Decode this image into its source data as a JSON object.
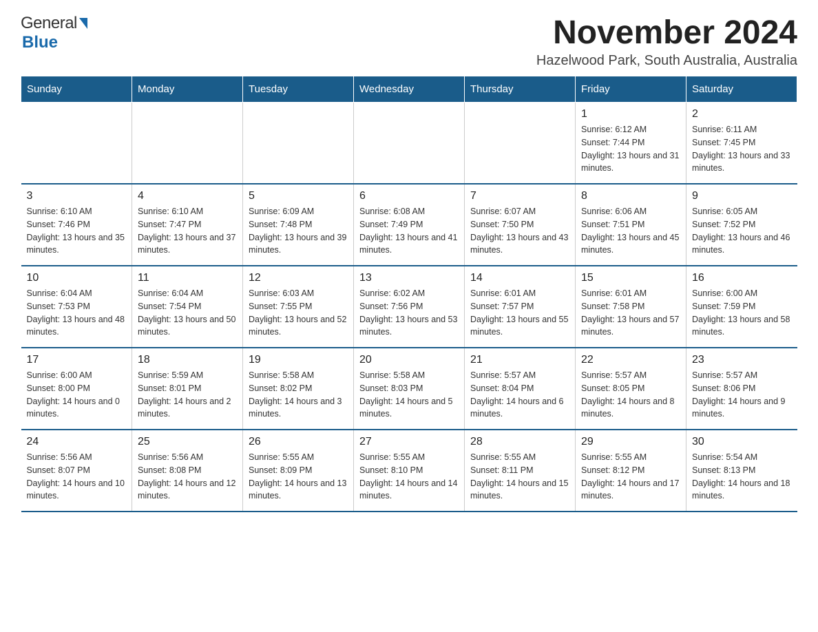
{
  "header": {
    "logo_general": "General",
    "logo_blue": "Blue",
    "month_title": "November 2024",
    "location": "Hazelwood Park, South Australia, Australia"
  },
  "weekdays": [
    "Sunday",
    "Monday",
    "Tuesday",
    "Wednesday",
    "Thursday",
    "Friday",
    "Saturday"
  ],
  "weeks": [
    [
      {
        "day": "",
        "sunrise": "",
        "sunset": "",
        "daylight": ""
      },
      {
        "day": "",
        "sunrise": "",
        "sunset": "",
        "daylight": ""
      },
      {
        "day": "",
        "sunrise": "",
        "sunset": "",
        "daylight": ""
      },
      {
        "day": "",
        "sunrise": "",
        "sunset": "",
        "daylight": ""
      },
      {
        "day": "",
        "sunrise": "",
        "sunset": "",
        "daylight": ""
      },
      {
        "day": "1",
        "sunrise": "Sunrise: 6:12 AM",
        "sunset": "Sunset: 7:44 PM",
        "daylight": "Daylight: 13 hours and 31 minutes."
      },
      {
        "day": "2",
        "sunrise": "Sunrise: 6:11 AM",
        "sunset": "Sunset: 7:45 PM",
        "daylight": "Daylight: 13 hours and 33 minutes."
      }
    ],
    [
      {
        "day": "3",
        "sunrise": "Sunrise: 6:10 AM",
        "sunset": "Sunset: 7:46 PM",
        "daylight": "Daylight: 13 hours and 35 minutes."
      },
      {
        "day": "4",
        "sunrise": "Sunrise: 6:10 AM",
        "sunset": "Sunset: 7:47 PM",
        "daylight": "Daylight: 13 hours and 37 minutes."
      },
      {
        "day": "5",
        "sunrise": "Sunrise: 6:09 AM",
        "sunset": "Sunset: 7:48 PM",
        "daylight": "Daylight: 13 hours and 39 minutes."
      },
      {
        "day": "6",
        "sunrise": "Sunrise: 6:08 AM",
        "sunset": "Sunset: 7:49 PM",
        "daylight": "Daylight: 13 hours and 41 minutes."
      },
      {
        "day": "7",
        "sunrise": "Sunrise: 6:07 AM",
        "sunset": "Sunset: 7:50 PM",
        "daylight": "Daylight: 13 hours and 43 minutes."
      },
      {
        "day": "8",
        "sunrise": "Sunrise: 6:06 AM",
        "sunset": "Sunset: 7:51 PM",
        "daylight": "Daylight: 13 hours and 45 minutes."
      },
      {
        "day": "9",
        "sunrise": "Sunrise: 6:05 AM",
        "sunset": "Sunset: 7:52 PM",
        "daylight": "Daylight: 13 hours and 46 minutes."
      }
    ],
    [
      {
        "day": "10",
        "sunrise": "Sunrise: 6:04 AM",
        "sunset": "Sunset: 7:53 PM",
        "daylight": "Daylight: 13 hours and 48 minutes."
      },
      {
        "day": "11",
        "sunrise": "Sunrise: 6:04 AM",
        "sunset": "Sunset: 7:54 PM",
        "daylight": "Daylight: 13 hours and 50 minutes."
      },
      {
        "day": "12",
        "sunrise": "Sunrise: 6:03 AM",
        "sunset": "Sunset: 7:55 PM",
        "daylight": "Daylight: 13 hours and 52 minutes."
      },
      {
        "day": "13",
        "sunrise": "Sunrise: 6:02 AM",
        "sunset": "Sunset: 7:56 PM",
        "daylight": "Daylight: 13 hours and 53 minutes."
      },
      {
        "day": "14",
        "sunrise": "Sunrise: 6:01 AM",
        "sunset": "Sunset: 7:57 PM",
        "daylight": "Daylight: 13 hours and 55 minutes."
      },
      {
        "day": "15",
        "sunrise": "Sunrise: 6:01 AM",
        "sunset": "Sunset: 7:58 PM",
        "daylight": "Daylight: 13 hours and 57 minutes."
      },
      {
        "day": "16",
        "sunrise": "Sunrise: 6:00 AM",
        "sunset": "Sunset: 7:59 PM",
        "daylight": "Daylight: 13 hours and 58 minutes."
      }
    ],
    [
      {
        "day": "17",
        "sunrise": "Sunrise: 6:00 AM",
        "sunset": "Sunset: 8:00 PM",
        "daylight": "Daylight: 14 hours and 0 minutes."
      },
      {
        "day": "18",
        "sunrise": "Sunrise: 5:59 AM",
        "sunset": "Sunset: 8:01 PM",
        "daylight": "Daylight: 14 hours and 2 minutes."
      },
      {
        "day": "19",
        "sunrise": "Sunrise: 5:58 AM",
        "sunset": "Sunset: 8:02 PM",
        "daylight": "Daylight: 14 hours and 3 minutes."
      },
      {
        "day": "20",
        "sunrise": "Sunrise: 5:58 AM",
        "sunset": "Sunset: 8:03 PM",
        "daylight": "Daylight: 14 hours and 5 minutes."
      },
      {
        "day": "21",
        "sunrise": "Sunrise: 5:57 AM",
        "sunset": "Sunset: 8:04 PM",
        "daylight": "Daylight: 14 hours and 6 minutes."
      },
      {
        "day": "22",
        "sunrise": "Sunrise: 5:57 AM",
        "sunset": "Sunset: 8:05 PM",
        "daylight": "Daylight: 14 hours and 8 minutes."
      },
      {
        "day": "23",
        "sunrise": "Sunrise: 5:57 AM",
        "sunset": "Sunset: 8:06 PM",
        "daylight": "Daylight: 14 hours and 9 minutes."
      }
    ],
    [
      {
        "day": "24",
        "sunrise": "Sunrise: 5:56 AM",
        "sunset": "Sunset: 8:07 PM",
        "daylight": "Daylight: 14 hours and 10 minutes."
      },
      {
        "day": "25",
        "sunrise": "Sunrise: 5:56 AM",
        "sunset": "Sunset: 8:08 PM",
        "daylight": "Daylight: 14 hours and 12 minutes."
      },
      {
        "day": "26",
        "sunrise": "Sunrise: 5:55 AM",
        "sunset": "Sunset: 8:09 PM",
        "daylight": "Daylight: 14 hours and 13 minutes."
      },
      {
        "day": "27",
        "sunrise": "Sunrise: 5:55 AM",
        "sunset": "Sunset: 8:10 PM",
        "daylight": "Daylight: 14 hours and 14 minutes."
      },
      {
        "day": "28",
        "sunrise": "Sunrise: 5:55 AM",
        "sunset": "Sunset: 8:11 PM",
        "daylight": "Daylight: 14 hours and 15 minutes."
      },
      {
        "day": "29",
        "sunrise": "Sunrise: 5:55 AM",
        "sunset": "Sunset: 8:12 PM",
        "daylight": "Daylight: 14 hours and 17 minutes."
      },
      {
        "day": "30",
        "sunrise": "Sunrise: 5:54 AM",
        "sunset": "Sunset: 8:13 PM",
        "daylight": "Daylight: 14 hours and 18 minutes."
      }
    ]
  ]
}
